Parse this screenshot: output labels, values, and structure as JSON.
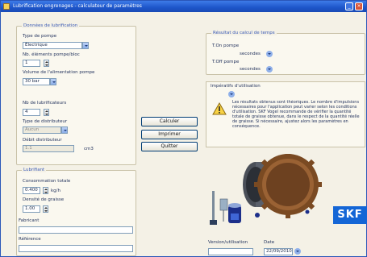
{
  "window": {
    "title": "Lubrification engrenages - calculateur de paramètres",
    "min_label": "_",
    "close_label": "×"
  },
  "left_panel": {
    "group1_title": "Données de lubrification",
    "type_label": "Type de pompe",
    "type_value": "Électrique",
    "elements_label": "Nb. éléments pompe/bloc",
    "elements_value": "1",
    "capacity_label": "Volume de l'alimentation pompe",
    "capacity_value": "30 bar",
    "mult_label": "Nb de lubrificateurs",
    "mult_value": "4",
    "dist_type_label": "Type de distributeur",
    "dist_type_value": "Aucun",
    "flow_label": "Débit distributeur",
    "flow_value": "1.1",
    "flow_unit": "cm3",
    "group2_title": "Lubrifiant",
    "consumption_label": "Consommation totale",
    "consumption_value": "0.400",
    "consumption_unit": "kg/h",
    "density_label": "Densité de graisse",
    "density_value": "1.00",
    "maker_label": "Fabricant",
    "maker_value": "",
    "ref_label": "Référence",
    "ref_value": ""
  },
  "center_buttons": {
    "calculate": "Calculer",
    "print": "Imprimer",
    "close": "Quitter"
  },
  "right_panel": {
    "result_title": "Résultat du calcul de temps",
    "t_on_label": "T.On pompe",
    "t_on_unit": "secondes",
    "t_off_label": "T.Off pompe",
    "t_off_unit": "secondes",
    "warnings_title": "Impératifs d'utilisation",
    "warning_text": "Les résultats obtenus sont théoriques. Le nombre d'impulsions nécessaires pour l'application peut varier selon les conditions d'utilisation. SKF Vogel recommande de vérifier la quantité totale de graisse obtenue, dans le respect de la quantité réelle de graisse. Si nécessaire, ajustez alors les paramètres en conséquence.",
    "version_label": "Version/utilisation",
    "version_value": "",
    "date_label": "Date",
    "date_value": "22/09/2010"
  },
  "brand": {
    "logo_text": "SKF",
    "accent": "#1466d6"
  }
}
